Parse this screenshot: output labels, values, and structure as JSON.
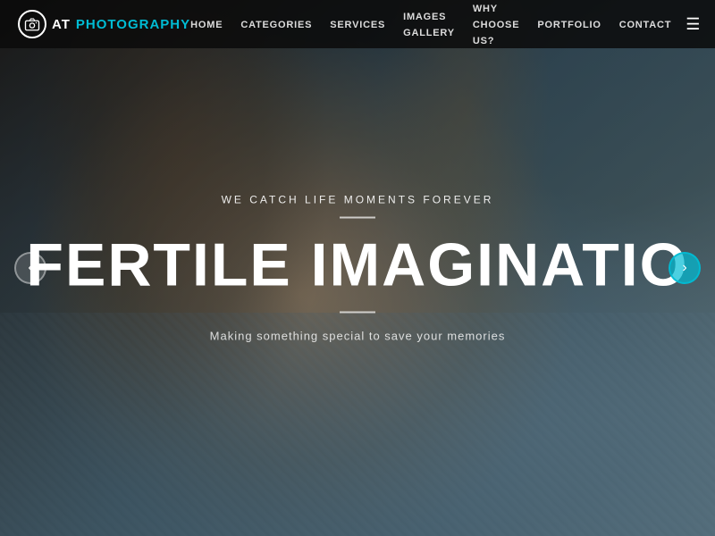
{
  "brand": {
    "prefix": "AT",
    "name": "PHOTOGRAPHY"
  },
  "nav": {
    "links": [
      {
        "label": "HOME",
        "active": true
      },
      {
        "label": "CATEGORIES",
        "active": false
      },
      {
        "label": "SERVICES",
        "active": false
      },
      {
        "label": "IMAGES GALLERY",
        "active": false
      },
      {
        "label": "WHY CHOOSE US?",
        "active": false
      },
      {
        "label": "PORTFOLIO",
        "active": false
      },
      {
        "label": "CONTACT",
        "active": false
      }
    ]
  },
  "hero": {
    "tagline": "WE CATCH LIFE MOMENTS FOREVER",
    "title": "FERTILE IMAGINATIO",
    "subtitle": "Making something special to save your memories"
  },
  "arrows": {
    "left": "‹",
    "right": "›"
  }
}
